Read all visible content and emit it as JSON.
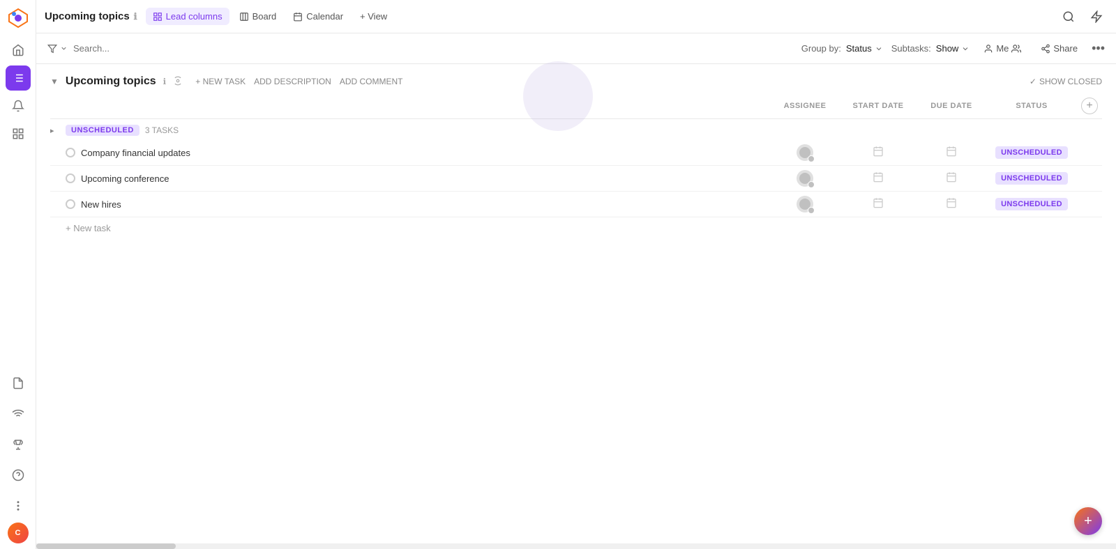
{
  "app": {
    "title": "Upcoming topics",
    "info_icon": "ℹ",
    "logo_gradient": [
      "#f97316",
      "#7c3aed",
      "#3b82f6"
    ]
  },
  "tabs": [
    {
      "id": "lead-columns",
      "label": "Lead columns",
      "icon": "grid",
      "active": true
    },
    {
      "id": "board",
      "label": "Board",
      "icon": "board",
      "active": false
    },
    {
      "id": "calendar",
      "label": "Calendar",
      "icon": "calendar",
      "active": false
    },
    {
      "id": "view",
      "label": "+ View",
      "icon": "",
      "active": false
    }
  ],
  "toolbar": {
    "filter_label": "Search...",
    "group_by_label": "Group by:",
    "group_by_value": "Status",
    "subtasks_label": "Subtasks:",
    "subtasks_value": "Show",
    "me_label": "Me",
    "share_label": "Share"
  },
  "group": {
    "title": "Upcoming topics",
    "new_task_label": "+ NEW TASK",
    "add_description_label": "ADD DESCRIPTION",
    "add_comment_label": "ADD COMMENT",
    "show_closed_label": "SHOW CLOSED"
  },
  "table": {
    "columns": {
      "assignee": "ASSIGNEE",
      "start_date": "START DATE",
      "due_date": "DUE DATE",
      "status": "STATUS"
    },
    "status_group": {
      "label": "UNSCHEDULED",
      "count": "3 TASKS"
    },
    "tasks": [
      {
        "id": 1,
        "name": "Company financial updates",
        "status": "UNSCHEDULED"
      },
      {
        "id": 2,
        "name": "Upcoming conference",
        "status": "UNSCHEDULED"
      },
      {
        "id": 3,
        "name": "New hires",
        "status": "UNSCHEDULED"
      }
    ],
    "new_task_label": "+ New task"
  },
  "sidebar": {
    "icons": [
      {
        "id": "home",
        "symbol": "⌂",
        "active": false
      },
      {
        "id": "list",
        "symbol": "≡",
        "active": true
      },
      {
        "id": "bell",
        "symbol": "🔔",
        "active": false
      },
      {
        "id": "apps",
        "symbol": "⊞",
        "active": false
      }
    ],
    "bottom_icons": [
      {
        "id": "doc",
        "symbol": "📄",
        "active": false
      },
      {
        "id": "signal",
        "symbol": "((•))",
        "active": false
      },
      {
        "id": "trophy",
        "symbol": "🏆",
        "active": false
      },
      {
        "id": "help",
        "symbol": "?",
        "active": false
      },
      {
        "id": "more",
        "symbol": "⋮",
        "active": false
      }
    ],
    "avatar_label": "C"
  },
  "fab_label": "+"
}
